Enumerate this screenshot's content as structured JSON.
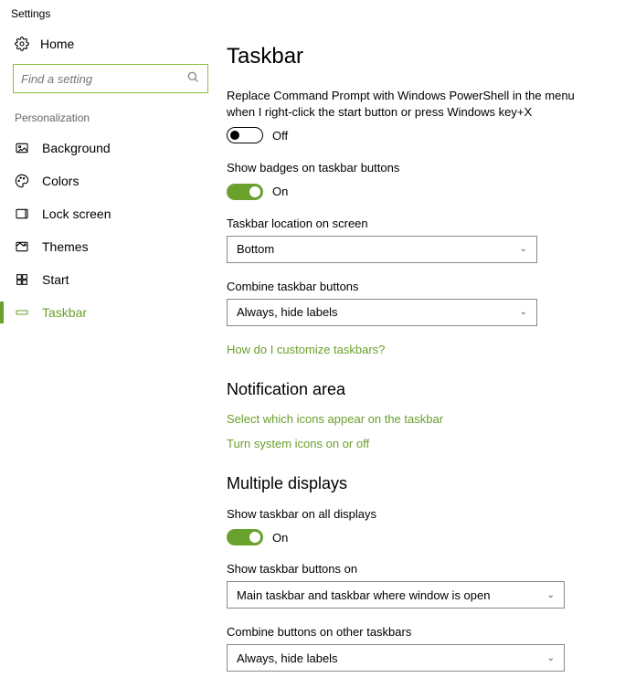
{
  "window": {
    "title": "Settings"
  },
  "sidebar": {
    "home": "Home",
    "search_placeholder": "Find a setting",
    "category": "Personalization",
    "items": [
      {
        "label": "Background"
      },
      {
        "label": "Colors"
      },
      {
        "label": "Lock screen"
      },
      {
        "label": "Themes"
      },
      {
        "label": "Start"
      },
      {
        "label": "Taskbar"
      }
    ]
  },
  "main": {
    "title": "Taskbar",
    "powershell_desc": "Replace Command Prompt with Windows PowerShell in the menu when I right-click the start button or press Windows key+X",
    "off": "Off",
    "on": "On",
    "badges_desc": "Show badges on taskbar buttons",
    "location_label": "Taskbar location on screen",
    "location_value": "Bottom",
    "combine_label": "Combine taskbar buttons",
    "combine_value": "Always, hide labels",
    "customize_link": "How do I customize taskbars?",
    "notif_title": "Notification area",
    "notif_link1": "Select which icons appear on the taskbar",
    "notif_link2": "Turn system icons on or off",
    "multi_title": "Multiple displays",
    "multi_show_desc": "Show taskbar on all displays",
    "multi_buttons_label": "Show taskbar buttons on",
    "multi_buttons_value": "Main taskbar and taskbar where window is open",
    "multi_combine_label": "Combine buttons on other taskbars",
    "multi_combine_value": "Always, hide labels"
  }
}
